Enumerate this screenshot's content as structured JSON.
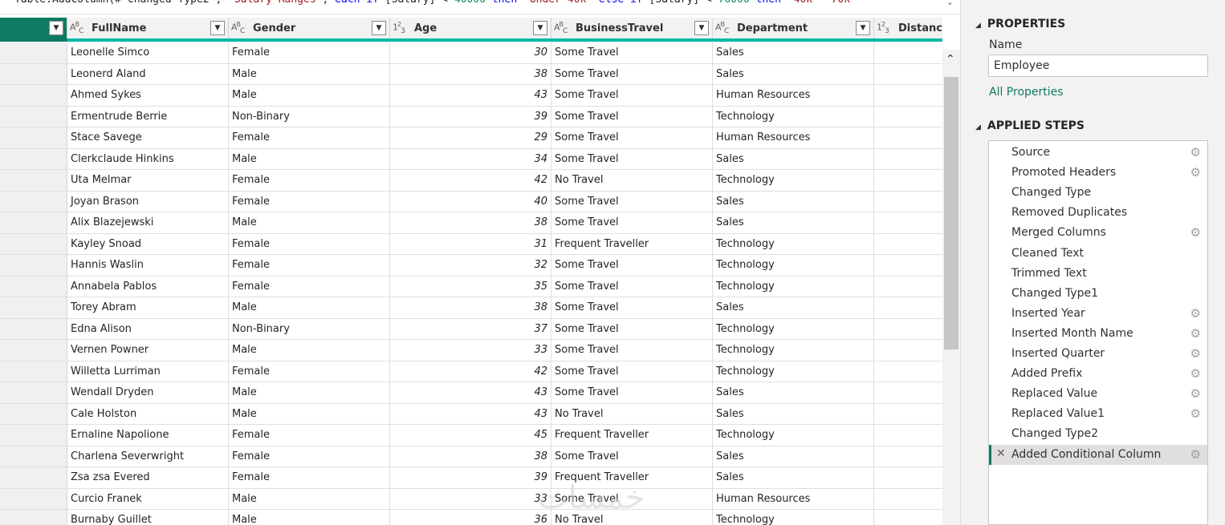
{
  "formula": {
    "segments": [
      {
        "text": "Table.AddColumn(#\"Changed Type2\", ",
        "kind": "plain"
      },
      {
        "text": "\"Salary Ranges\"",
        "kind": "str"
      },
      {
        "text": ", ",
        "kind": "plain"
      },
      {
        "text": "each if",
        "kind": "kw"
      },
      {
        "text": " [Salary] < ",
        "kind": "plain"
      },
      {
        "text": "40000",
        "kind": "num"
      },
      {
        "text": " then ",
        "kind": "kw"
      },
      {
        "text": "\"Under 40k\"",
        "kind": "str"
      },
      {
        "text": " else if",
        "kind": "kw"
      },
      {
        "text": " [Salary] < ",
        "kind": "plain"
      },
      {
        "text": "70000",
        "kind": "num"
      },
      {
        "text": " then ",
        "kind": "kw"
      },
      {
        "text": "\"40k - 70k\"",
        "kind": "str"
      }
    ],
    "expand_icon": "chevron-down-icon"
  },
  "columns": [
    {
      "type_icon": "ABC",
      "label": "FullName"
    },
    {
      "type_icon": "ABC",
      "label": "Gender"
    },
    {
      "type_icon": "123",
      "label": "Age"
    },
    {
      "type_icon": "ABC",
      "label": "BusinessTravel"
    },
    {
      "type_icon": "ABC",
      "label": "Department"
    },
    {
      "type_icon": "123",
      "label": "DistanceFrom"
    }
  ],
  "rows": [
    [
      "Leonelle Simco",
      "Female",
      "30",
      "Some Travel",
      "Sales"
    ],
    [
      "Leonerd Aland",
      "Male",
      "38",
      "Some Travel",
      "Sales"
    ],
    [
      "Ahmed Sykes",
      "Male",
      "43",
      "Some Travel",
      "Human Resources"
    ],
    [
      "Ermentrude Berrie",
      "Non-Binary",
      "39",
      "Some Travel",
      "Technology"
    ],
    [
      "Stace Savege",
      "Female",
      "29",
      "Some Travel",
      "Human Resources"
    ],
    [
      "Clerkclaude Hinkins",
      "Male",
      "34",
      "Some Travel",
      "Sales"
    ],
    [
      "Uta Melmar",
      "Female",
      "42",
      "No Travel",
      "Technology"
    ],
    [
      "Joyan Brason",
      "Female",
      "40",
      "Some Travel",
      "Sales"
    ],
    [
      "Alix Blazejewski",
      "Male",
      "38",
      "Some Travel",
      "Sales"
    ],
    [
      "Kayley Snoad",
      "Female",
      "31",
      "Frequent Traveller",
      "Technology"
    ],
    [
      "Hannis Waslin",
      "Female",
      "32",
      "Some Travel",
      "Technology"
    ],
    [
      "Annabela Pablos",
      "Female",
      "35",
      "Some Travel",
      "Technology"
    ],
    [
      "Torey Abram",
      "Male",
      "38",
      "Some Travel",
      "Sales"
    ],
    [
      "Edna Alison",
      "Non-Binary",
      "37",
      "Some Travel",
      "Technology"
    ],
    [
      "Vernen Powner",
      "Male",
      "33",
      "Some Travel",
      "Technology"
    ],
    [
      "Willetta Lurriman",
      "Female",
      "42",
      "Some Travel",
      "Technology"
    ],
    [
      "Wendall Dryden",
      "Male",
      "43",
      "Some Travel",
      "Sales"
    ],
    [
      "Cale Holston",
      "Male",
      "43",
      "No Travel",
      "Sales"
    ],
    [
      "Ernaline Napolione",
      "Female",
      "45",
      "Frequent Traveller",
      "Technology"
    ],
    [
      "Charlena Severwright",
      "Female",
      "38",
      "Some Travel",
      "Sales"
    ],
    [
      "Zsa zsa Evered",
      "Female",
      "39",
      "Frequent Traveller",
      "Sales"
    ],
    [
      "Curcio Franek",
      "Male",
      "33",
      "Some Travel",
      "Human Resources"
    ],
    [
      "Burnaby Guillet",
      "Male",
      "36",
      "No Travel",
      "Technology"
    ]
  ],
  "watermark": "خمسات",
  "panel": {
    "properties_title": "PROPERTIES",
    "name_label": "Name",
    "name_value": "Employee",
    "all_properties": "All Properties",
    "applied_steps_title": "APPLIED STEPS",
    "steps": [
      {
        "label": "Source",
        "gear": true
      },
      {
        "label": "Promoted Headers",
        "gear": true
      },
      {
        "label": "Changed Type",
        "gear": false
      },
      {
        "label": "Removed Duplicates",
        "gear": false
      },
      {
        "label": "Merged Columns",
        "gear": true
      },
      {
        "label": "Cleaned Text",
        "gear": false
      },
      {
        "label": "Trimmed Text",
        "gear": false
      },
      {
        "label": "Changed Type1",
        "gear": false
      },
      {
        "label": "Inserted Year",
        "gear": true
      },
      {
        "label": "Inserted Month Name",
        "gear": true
      },
      {
        "label": "Inserted Quarter",
        "gear": true
      },
      {
        "label": "Added Prefix",
        "gear": true
      },
      {
        "label": "Replaced Value",
        "gear": true
      },
      {
        "label": "Replaced Value1",
        "gear": true
      },
      {
        "label": "Changed Type2",
        "gear": false
      },
      {
        "label": "Added Conditional Column",
        "gear": true,
        "selected": true
      }
    ]
  }
}
